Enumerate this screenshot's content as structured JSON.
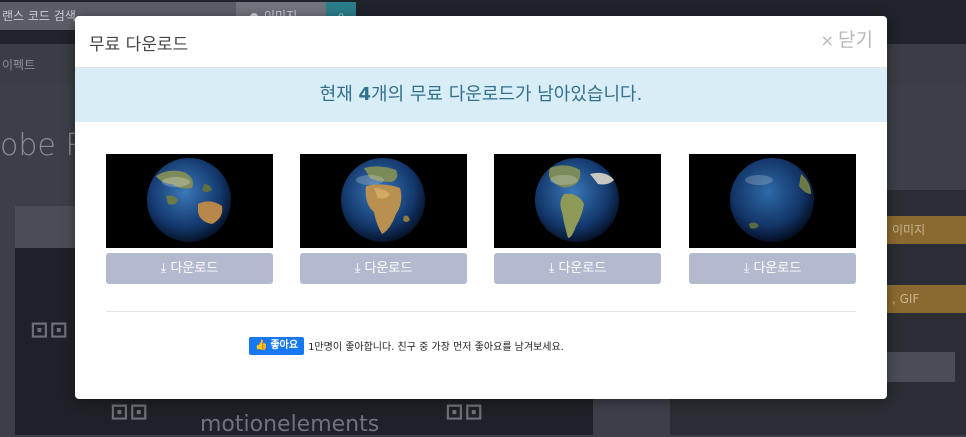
{
  "background": {
    "search_text": "랜스 코드 검색",
    "image_pill": "이미지",
    "nav_item": "이펙트",
    "page_title": "obe R",
    "brand": "motionelements",
    "sidebar_btn1": "이미지",
    "sidebar_btn2": ", GIF"
  },
  "modal": {
    "title": "무료 다운로드",
    "close_label": "닫기",
    "notice_prefix": "현재 ",
    "notice_count": "4",
    "notice_suffix": "개의 무료 다운로드가 남아있습니다.",
    "items": [
      {
        "download_label": "다운로드",
        "globe": "australia"
      },
      {
        "download_label": "다운로드",
        "globe": "africa"
      },
      {
        "download_label": "다운로드",
        "globe": "americas"
      },
      {
        "download_label": "다운로드",
        "globe": "pacific"
      }
    ],
    "facebook": {
      "like_label": "좋아요",
      "like_text": "1만명이 좋아합니다. 친구 중 가장 먼저 좋아요를 남겨보세요."
    }
  },
  "icons": {
    "close": "times-icon",
    "download": "download-icon",
    "like": "thumbs-up-icon"
  },
  "colors": {
    "notice_bg": "#d9edf7",
    "notice_text": "#31708f",
    "download_btn": "#b3bacf",
    "facebook_blue": "#1877f2"
  }
}
